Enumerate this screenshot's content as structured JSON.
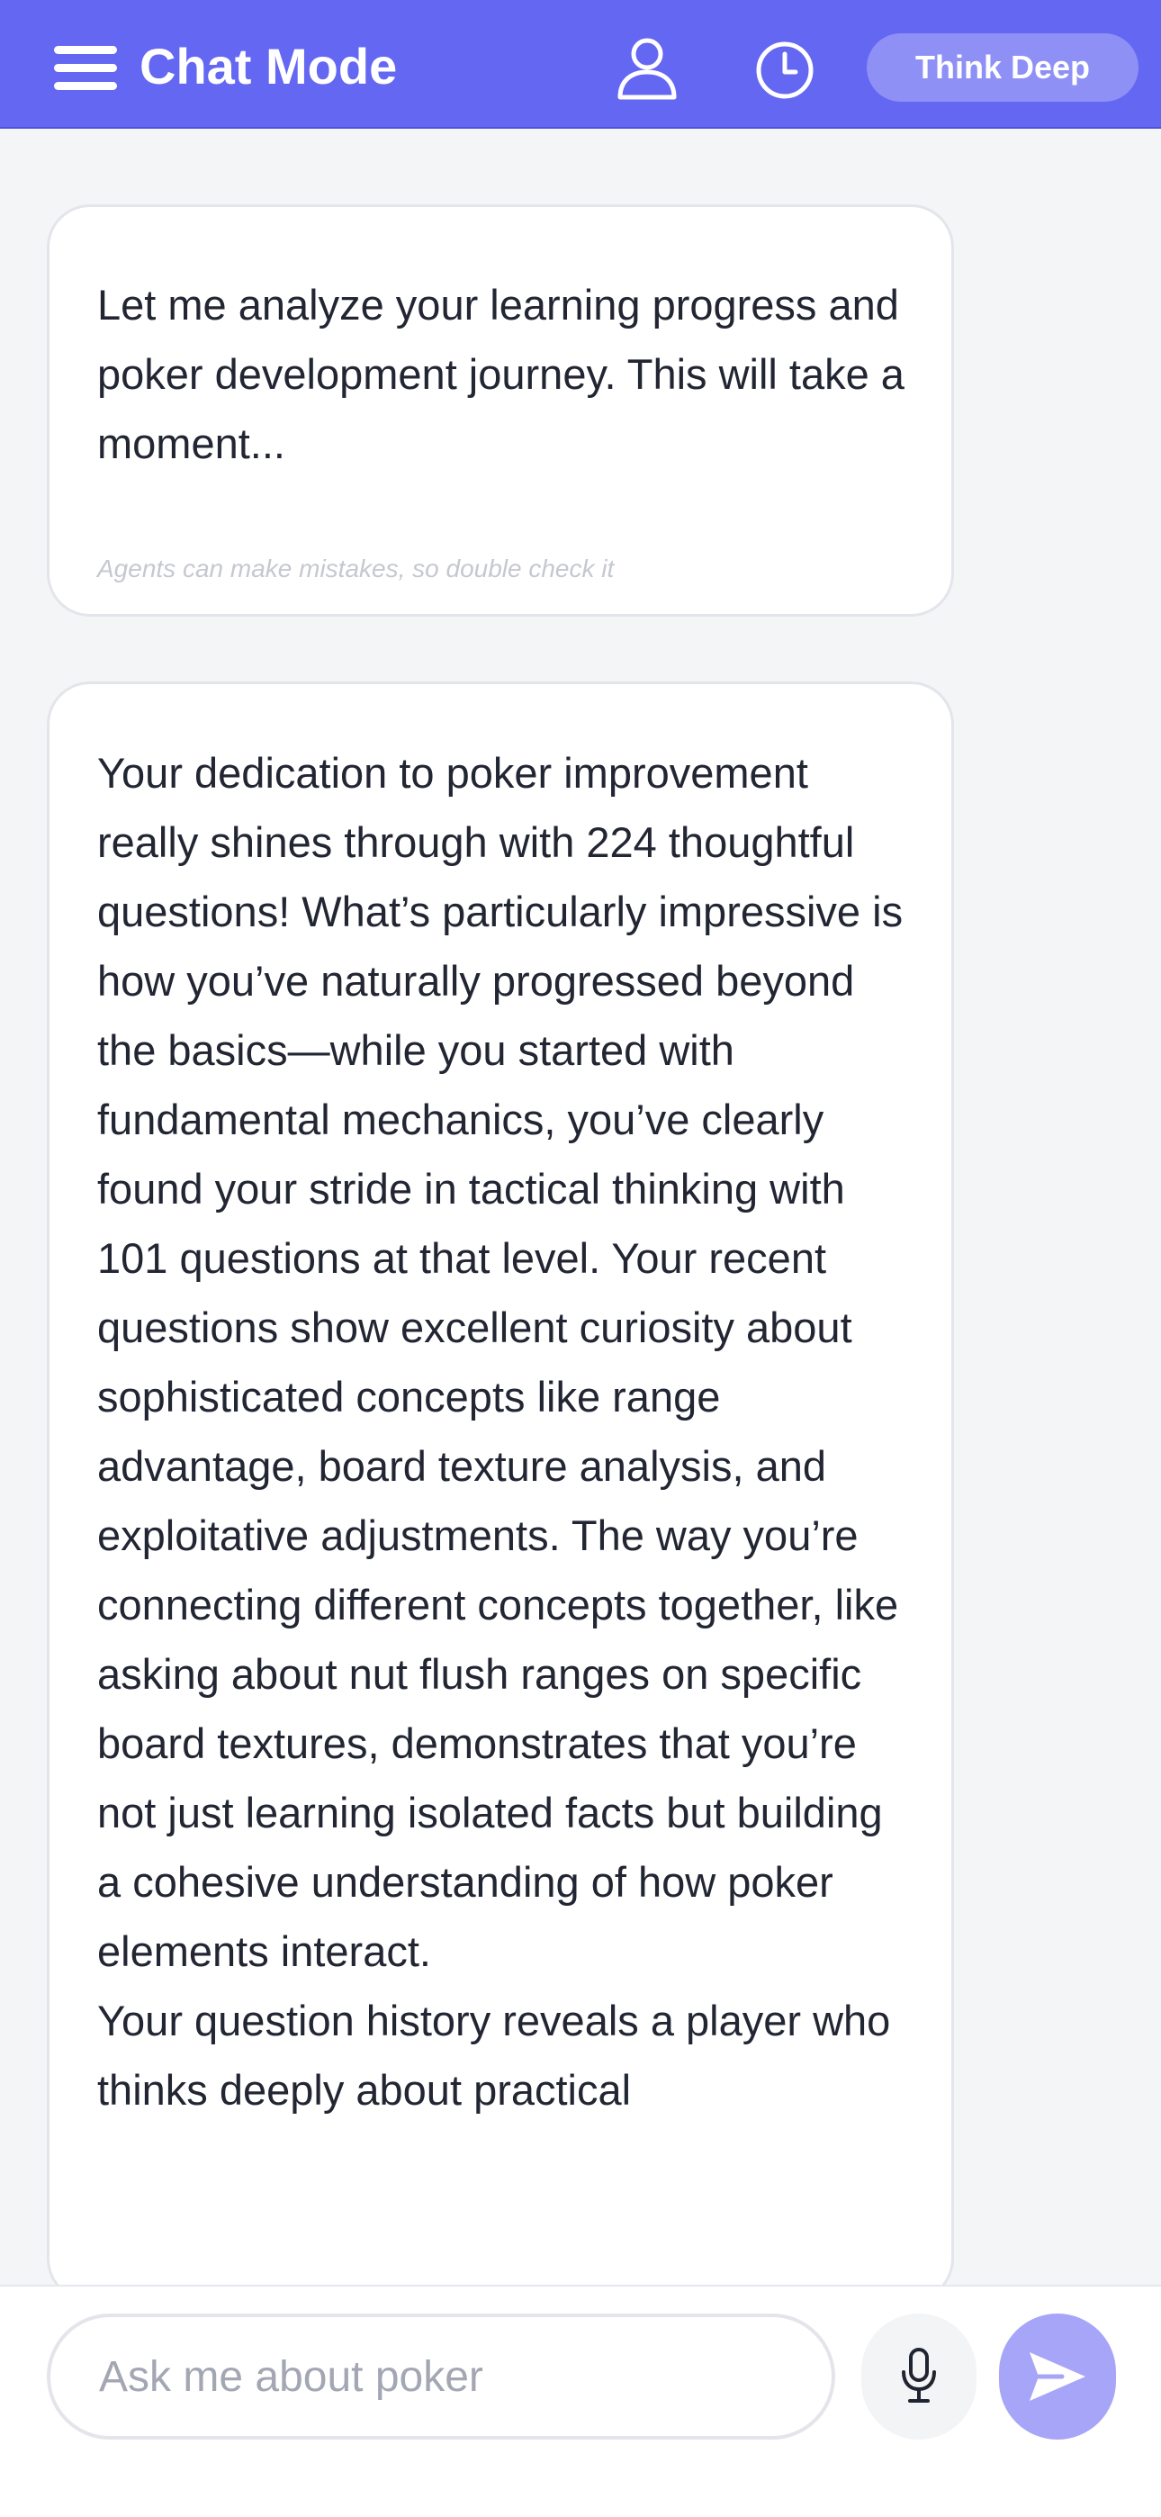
{
  "header": {
    "title": "Chat Mode",
    "menu_icon": "hamburger-menu-icon",
    "profile_icon": "user-icon",
    "history_icon": "clock-icon",
    "think_button_label": "Think Deep",
    "colors": {
      "background": "#6467f2",
      "think_button": "#8e90f5"
    }
  },
  "messages": [
    {
      "text": "Let me analyze your learning progress and poker development journey. This will take a moment...",
      "disclaimer": "Agents can make mistakes, so double check it"
    },
    {
      "paragraphs": [
        "Your dedication to poker improvement really shines through with 224 thoughtful questions! What’s particularly impressive is how you’ve naturally progressed beyond the basics—while you started with fundamental mechanics, you’ve clearly found your stride in tactical thinking with 101 questions at that level. Your recent questions show excellent curiosity about sophisticated concepts like range advantage, board texture analysis, and exploitative adjustments. The way you’re connecting different concepts together, like asking about nut flush ranges on specific board textures, demonstrates that you’re not just learning isolated facts but building a cohesive understanding of how poker elements interact.",
        "Your question history reveals a player who thinks deeply about practical"
      ]
    }
  ],
  "input": {
    "placeholder": "Ask me about poker",
    "value": "",
    "mic_icon": "microphone-icon",
    "send_icon": "send-arrow-icon",
    "colors": {
      "send_button": "#a7a5f7",
      "mic_button": "#f3f4f6"
    }
  }
}
